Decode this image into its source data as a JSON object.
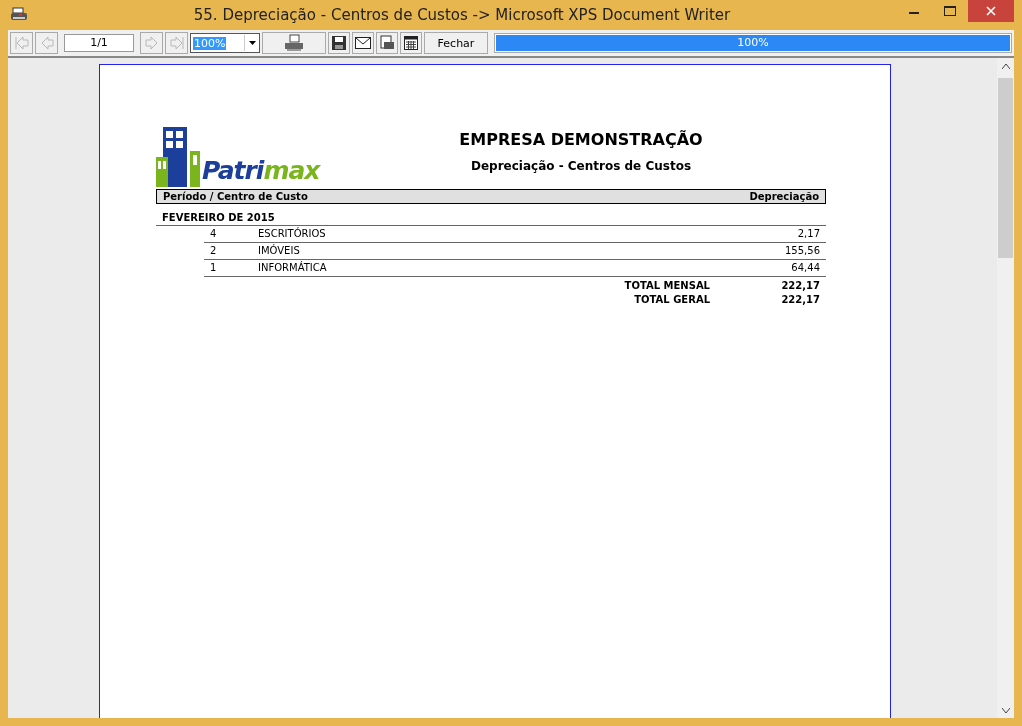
{
  "window": {
    "title": "55. Depreciação - Centros de Custos -> Microsoft XPS Document Writer"
  },
  "toolbar": {
    "nav_first_disabled": true,
    "nav_prev_disabled": true,
    "page_field": "1/1",
    "nav_next_disabled": true,
    "nav_last_disabled": true,
    "zoom": "100%",
    "close_button": "Fechar",
    "progress": {
      "level": 1,
      "reading": "100%"
    }
  },
  "report": {
    "logo_text": "Patri",
    "logo_text_accent": "max",
    "company": "EMPRESA DEMONSTRAÇÃO",
    "title": "Depreciação - Centros de Custos",
    "columns": [
      "Período / Centro de Custo",
      "Depreciação"
    ],
    "period": "FEVEREIRO DE 2015",
    "rows": [
      {
        "code": "4",
        "name": "ESCRITÓRIOS",
        "value": "2,17"
      },
      {
        "code": "2",
        "name": "IMÓVEIS",
        "value": "155,56"
      },
      {
        "code": "1",
        "name": "INFORMÁTICA",
        "value": "64,44"
      }
    ],
    "totals": [
      {
        "label": "TOTAL MENSAL",
        "value": "222,17"
      },
      {
        "label": "TOTAL GERAL",
        "value": "222,17"
      }
    ]
  }
}
